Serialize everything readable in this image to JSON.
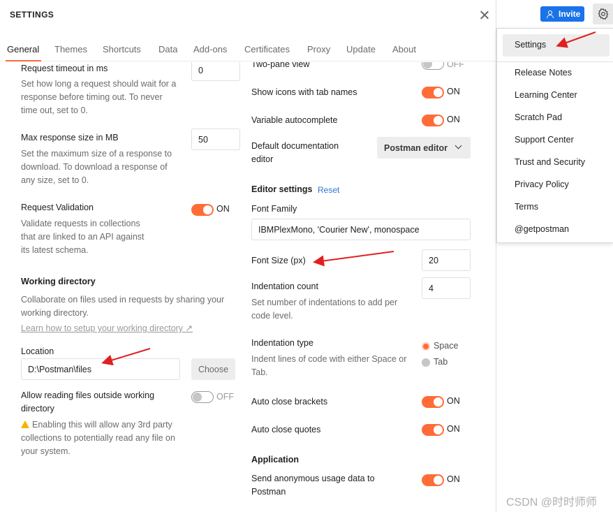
{
  "modal": {
    "title": "SETTINGS",
    "tabs": [
      "General",
      "Themes",
      "Shortcuts",
      "Data",
      "Add-ons",
      "Certificates",
      "Proxy",
      "Update",
      "About"
    ],
    "active_tab": "General"
  },
  "left": {
    "request_timeout": {
      "label": "Request timeout in ms",
      "desc": "Set how long a request should wait for a response before timing out. To never time out, set to 0.",
      "value": "0"
    },
    "max_response": {
      "label": "Max response size in MB",
      "desc": "Set the maximum size of a response to download. To download a response of any size, set to 0.",
      "value": "50"
    },
    "request_validation": {
      "label": "Request Validation",
      "desc": "Validate requests in collections that are linked to an API against its latest schema.",
      "state": "ON"
    },
    "working_directory": {
      "heading": "Working directory",
      "desc": "Collaborate on files used in requests by sharing your working directory.",
      "link": "Learn how to setup your working directory ↗"
    },
    "location": {
      "label": "Location",
      "value": "D:\\Postman\\files",
      "button": "Choose"
    },
    "allow_reading": {
      "label": "Allow reading files outside working directory",
      "state": "OFF",
      "warning": "Enabling this will allow any 3rd party collections to potentially read any file on your system."
    }
  },
  "right": {
    "two_pane": {
      "label": "Two-pane view",
      "state": "OFF"
    },
    "show_icons": {
      "label": "Show icons with tab names",
      "state": "ON"
    },
    "variable_autocomplete": {
      "label": "Variable autocomplete",
      "state": "ON"
    },
    "default_doc_editor": {
      "label": "Default documentation editor",
      "value": "Postman editor"
    },
    "editor_settings": {
      "heading": "Editor settings",
      "reset": "Reset"
    },
    "font_family": {
      "label": "Font Family",
      "value": "IBMPlexMono, 'Courier New', monospace"
    },
    "font_size": {
      "label": "Font Size (px)",
      "value": "20"
    },
    "indentation_count": {
      "label": "Indentation count",
      "desc": "Set number of indentations to add per code level.",
      "value": "4"
    },
    "indentation_type": {
      "label": "Indentation type",
      "desc": "Indent lines of code with either Space or Tab.",
      "options": [
        "Space",
        "Tab"
      ],
      "selected": "Space"
    },
    "auto_close_brackets": {
      "label": "Auto close brackets",
      "state": "ON"
    },
    "auto_close_quotes": {
      "label": "Auto close quotes",
      "state": "ON"
    },
    "application": {
      "heading": "Application"
    },
    "send_usage": {
      "label": "Send anonymous usage data to Postman",
      "state": "ON"
    }
  },
  "topbar": {
    "invite": "Invite"
  },
  "menu": {
    "items": [
      "Settings",
      "Release Notes",
      "Learning Center",
      "Scratch Pad",
      "Support Center",
      "Trust and Security",
      "Privacy Policy",
      "Terms",
      "@getpostman"
    ]
  },
  "watermark": "CSDN @时时师师",
  "colors": {
    "accent": "#ff6c37",
    "invite": "#1a73e8",
    "annotation_arrow": "#e02020"
  }
}
